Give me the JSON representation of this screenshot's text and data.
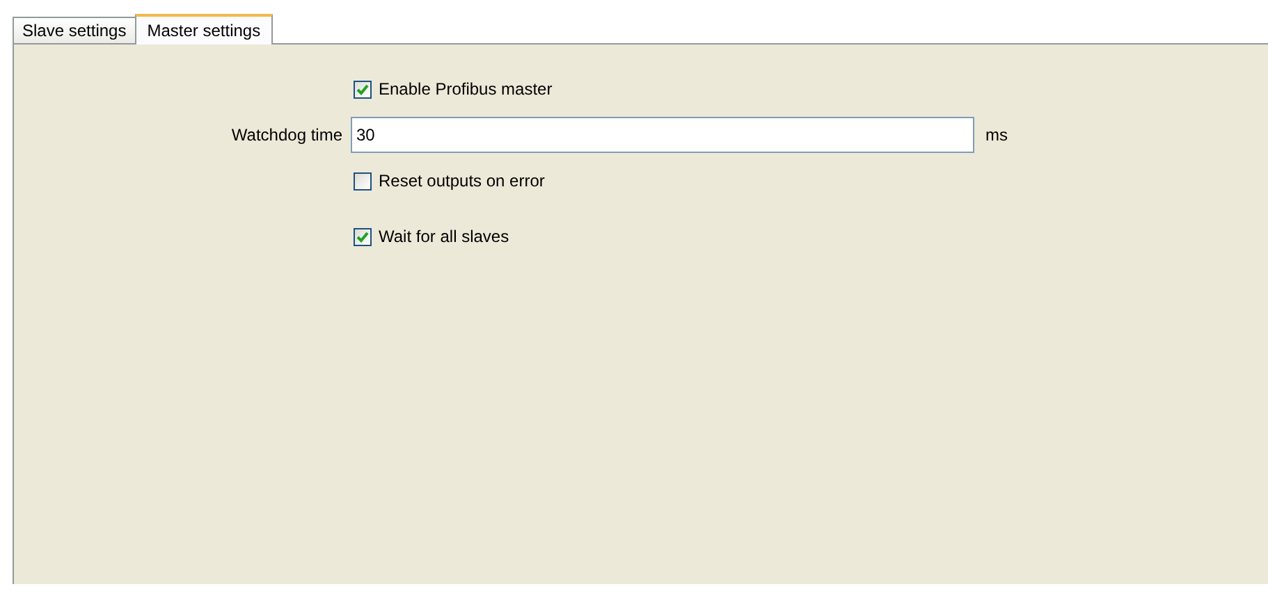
{
  "tabs": [
    {
      "label": "Slave settings",
      "selected": false
    },
    {
      "label": "Master settings",
      "selected": true
    }
  ],
  "settings": [
    {
      "kind": "checkbox",
      "label": "Enable Profibus master",
      "checked": true
    },
    {
      "kind": "field",
      "label": "Watchdog time",
      "value": "30",
      "unit": "ms"
    },
    {
      "kind": "checkbox",
      "label": "Reset outputs on error",
      "checked": false
    },
    {
      "kind": "checkbox",
      "label": "Wait for all slaves",
      "checked": true
    }
  ]
}
